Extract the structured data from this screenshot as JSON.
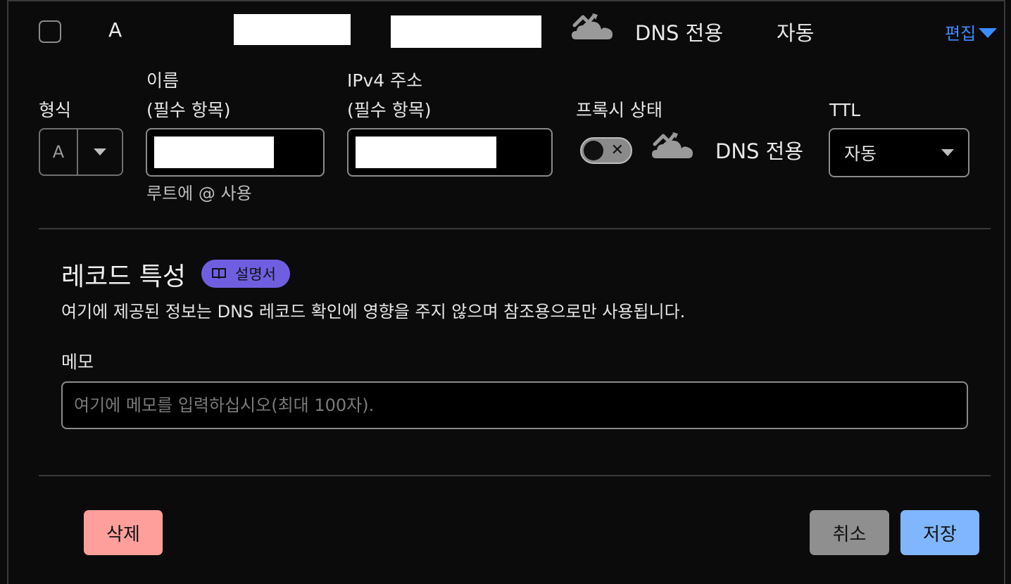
{
  "record_row": {
    "type": "A",
    "proxy_status": "DNS 전용",
    "ttl": "자동",
    "edit_label": "편집"
  },
  "form": {
    "type_label": "형식",
    "type_value": "A",
    "name_label": "이름",
    "name_required": "(필수 항목)",
    "name_hint": "루트에 @ 사용",
    "ipv4_label": "IPv4 주소",
    "ipv4_required": "(필수 항목)",
    "proxy_label": "프록시 상태",
    "proxy_toggle_x": "✕",
    "proxy_value": "DNS 전용",
    "ttl_label": "TTL",
    "ttl_value": "자동"
  },
  "properties": {
    "title": "레코드 특성",
    "doc_badge": "설명서",
    "description": "여기에 제공된 정보는 DNS 레코드 확인에 영향을 주지 않으며 참조용으로만 사용됩니다.",
    "memo_label": "메모",
    "memo_placeholder": "여기에 메모를 입력하십시오(최대 100자).",
    "memo_value": ""
  },
  "actions": {
    "delete": "삭제",
    "cancel": "취소",
    "save": "저장"
  },
  "colors": {
    "background": "#0b0b0b",
    "link": "#3b8cff",
    "badge": "#6f5fe0",
    "delete": "#ff9f9b",
    "cancel": "#8f8f8f",
    "save": "#7fb6ff"
  }
}
